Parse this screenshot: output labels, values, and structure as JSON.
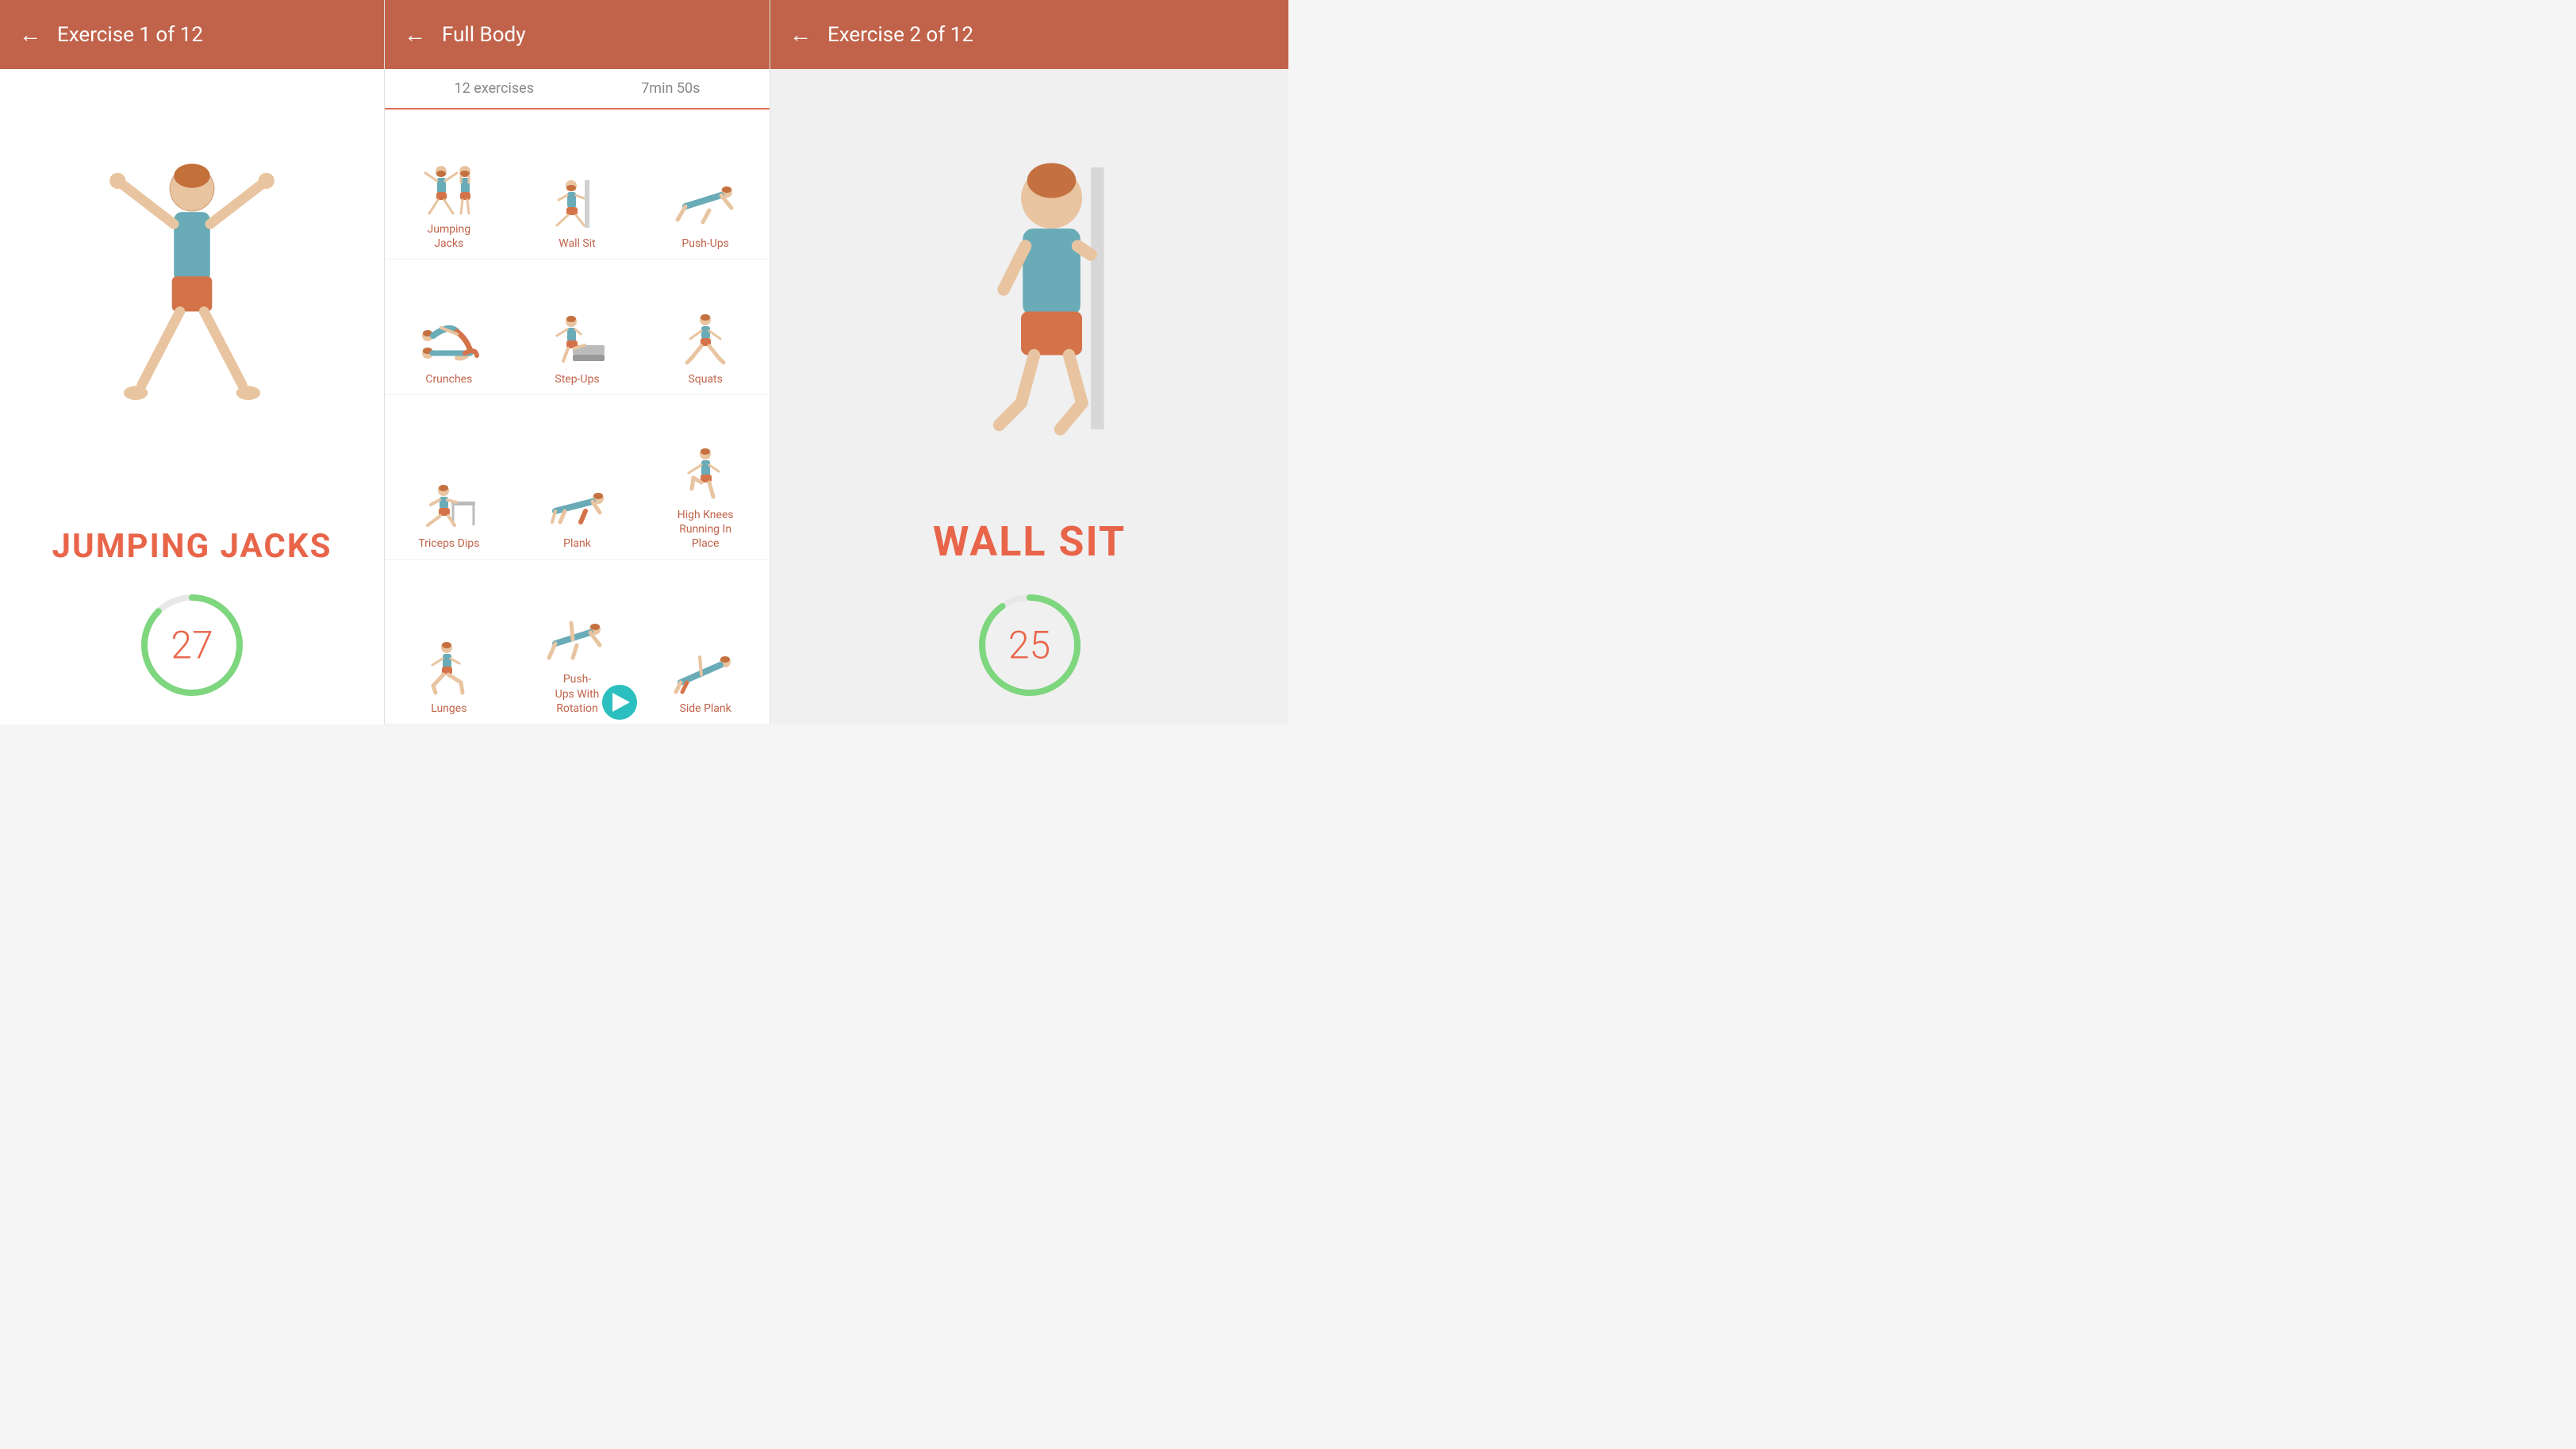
{
  "left_panel": {
    "header": {
      "back_label": "←",
      "title": "Exercise 1 of 12"
    },
    "exercise_name": "JUMPING JACKS",
    "timer_value": "27"
  },
  "center_panel": {
    "header": {
      "back_label": "←",
      "title": "Full Body"
    },
    "stats": {
      "exercises": "12 exercises",
      "duration": "7min 50s"
    },
    "exercises": [
      {
        "name": "Jumping\nJacks",
        "id": "jumping-jacks"
      },
      {
        "name": "Wall Sit",
        "id": "wall-sit"
      },
      {
        "name": "Push-Ups",
        "id": "push-ups"
      },
      {
        "name": "Crunches",
        "id": "crunches"
      },
      {
        "name": "Step-Ups",
        "id": "step-ups"
      },
      {
        "name": "Squats",
        "id": "squats"
      },
      {
        "name": "Triceps Dips",
        "id": "triceps-dips"
      },
      {
        "name": "Plank",
        "id": "plank"
      },
      {
        "name": "High Knees\nRunning In\nPlace",
        "id": "high-knees"
      },
      {
        "name": "Lunges",
        "id": "lunges"
      },
      {
        "name": "Push-\nUps With\nRotation",
        "id": "push-ups-rotation"
      },
      {
        "name": "Side Plank",
        "id": "side-plank"
      }
    ]
  },
  "right_panel": {
    "header": {
      "back_label": "←",
      "title": "Exercise 2 of 12"
    },
    "exercise_name": "WALL SIT",
    "timer_value": "25"
  }
}
